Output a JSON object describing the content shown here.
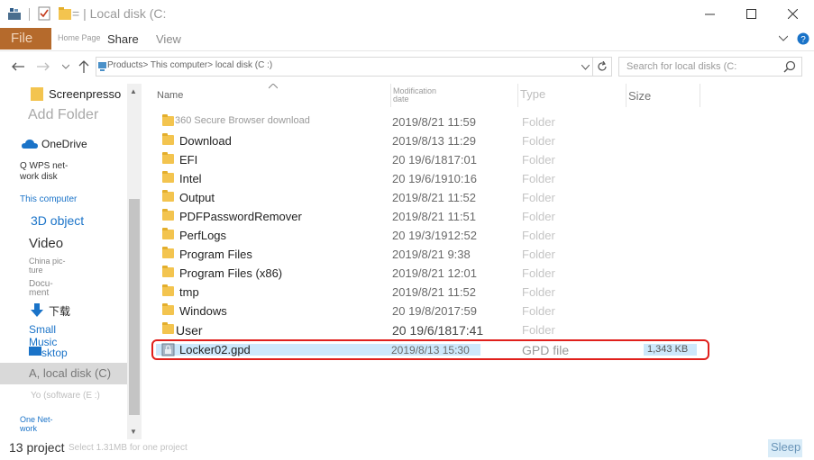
{
  "window": {
    "title": "= | Local disk (C:"
  },
  "ribbon": {
    "file_label": "File",
    "home_label": "Home Page",
    "share_label": "Share",
    "view_label": "View"
  },
  "address": {
    "path": "Products> This computer> local disk (C :)"
  },
  "search": {
    "placeholder": "Search for local disks (C:"
  },
  "nav": {
    "screenpresso": "Screenpresso",
    "add_folder": "Add Folder",
    "onedrive": "OneDrive",
    "wps_line1": "Q WPS net-",
    "wps_line2": "work disk",
    "this_computer": "This computer",
    "obj3d": "3D object",
    "video": "Video",
    "pictures_line1": "China pic-",
    "pictures_line2": "ture",
    "documents_line1": "Docu-",
    "documents_line2": "ment",
    "downloads": "下载",
    "music_line1": "Small",
    "music_line2": "Music",
    "desktop": "sktop",
    "local_disk": "A, local disk (C)",
    "software": "Yo (software (E :)",
    "network_line1": "One Net-",
    "network_line2": "work"
  },
  "columns": {
    "name": "Name",
    "date_line1": "Modification",
    "date_line2": "date",
    "type": "Type",
    "size": "Size"
  },
  "rows": [
    {
      "name": "360 Secure Browser download",
      "date": "2019/8/21 11:59",
      "type": "Folder"
    },
    {
      "name": "Download",
      "date": "2019/8/13 11:29",
      "type": "Folder"
    },
    {
      "name": "EFI",
      "date": "20 19/6/1817:01",
      "type": "Folder"
    },
    {
      "name": "Intel",
      "date": "20 19/6/1910:16",
      "type": "Folder"
    },
    {
      "name": "Output",
      "date": "2019/8/21 11:52",
      "type": "Folder"
    },
    {
      "name": "PDFPasswordRemover",
      "date": "2019/8/21 11:51",
      "type": "Folder"
    },
    {
      "name": "PerfLogs",
      "date": "20 19/3/1912:52",
      "type": "Folder"
    },
    {
      "name": "Program Files",
      "date": "2019/8/21 9:38",
      "type": "Folder"
    },
    {
      "name": "Program Files (x86)",
      "date": "2019/8/21 12:01",
      "type": "Folder"
    },
    {
      "name": "tmp",
      "date": "2019/8/21 11:52",
      "type": "Folder"
    },
    {
      "name": "Windows",
      "date": "20 19/8/2017:59",
      "type": "Folder"
    },
    {
      "name": "User",
      "date": "20 19/6/1817:41",
      "type": "Folder"
    }
  ],
  "selected_file": {
    "name": "Locker02.gpd",
    "date": "2019/8/13 15:30",
    "type": "GPD file",
    "size": "1,343 KB"
  },
  "status": {
    "count": "13 project",
    "selection": "Select 1.31MB for one project",
    "sleep": "Sleep"
  },
  "colors": {
    "file_tab": "#b56a2c",
    "folder": "#f3c44f",
    "highlight": "#e0201c",
    "selection": "#cde8fb",
    "link_blue": "#1a73c8"
  }
}
